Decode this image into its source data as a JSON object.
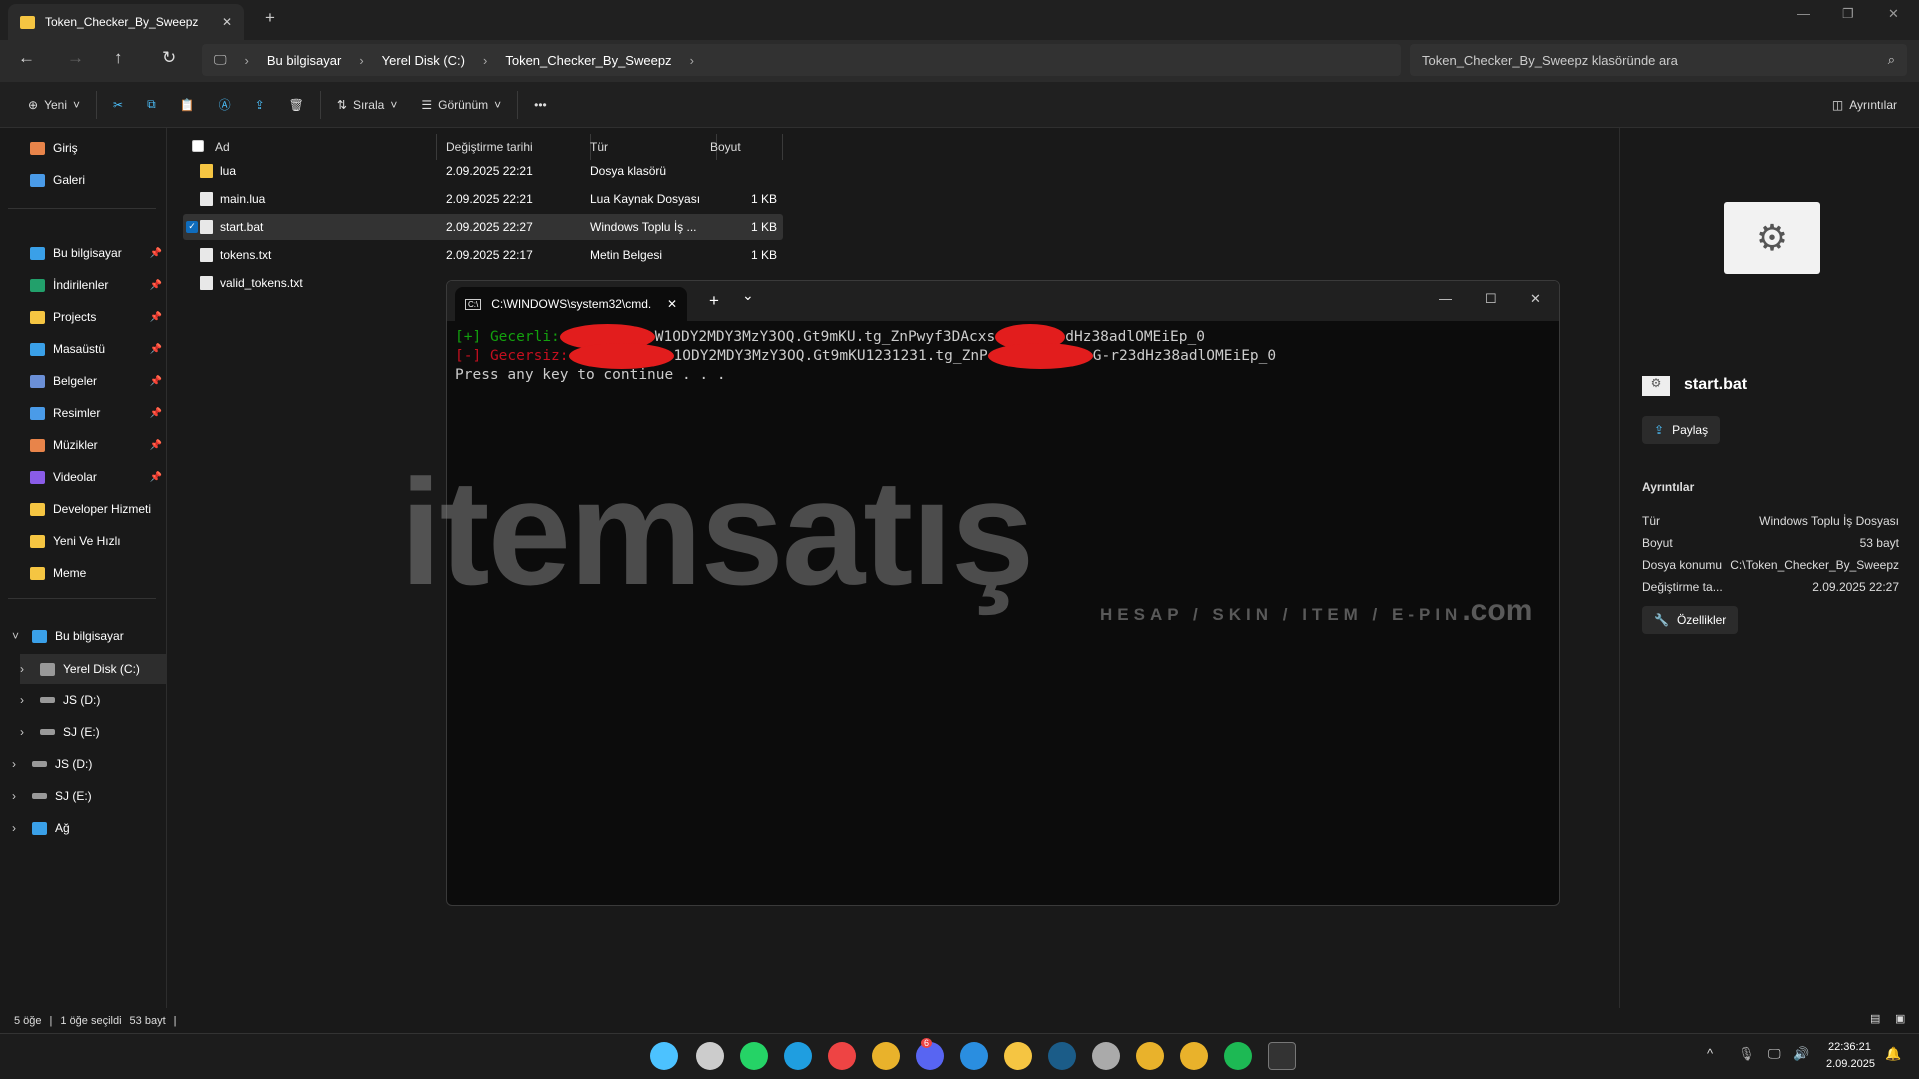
{
  "window": {
    "tab_title": "Token_Checker_By_Sweepz",
    "close": "✕",
    "new_tab": "+",
    "min": "—",
    "max": "❐",
    "closewin": "✕"
  },
  "nav": {
    "breadcrumb": [
      "Bu bilgisayar",
      "Yerel Disk (C:)",
      "Token_Checker_By_Sweepz"
    ],
    "search_placeholder": "Token_Checker_By_Sweepz klasöründe ara"
  },
  "toolbar": {
    "new": "Yeni",
    "sort": "Sırala",
    "view": "Görünüm",
    "more": "•••",
    "details": "Ayrıntılar"
  },
  "sidebar": {
    "quick": [
      "Giriş",
      "Galeri"
    ],
    "pinned": [
      "Bu bilgisayar",
      "İndirilenler",
      "Projects",
      "Masaüstü",
      "Belgeler",
      "Resimler",
      "Müzikler",
      "Videolar",
      "Developer Hizmeti",
      "Yeni Ve Hızlı",
      "Meme"
    ],
    "tree": [
      "Bu bilgisayar",
      "Yerel Disk (C:)",
      "JS (D:)",
      "SJ (E:)",
      "JS (D:)",
      "SJ (E:)",
      "Ağ"
    ]
  },
  "columns": [
    "Ad",
    "Değiştirme tarihi",
    "Tür",
    "Boyut"
  ],
  "files": [
    {
      "name": "lua",
      "date": "2.09.2025 22:21",
      "type": "Dosya klasörü",
      "size": ""
    },
    {
      "name": "main.lua",
      "date": "2.09.2025 22:21",
      "type": "Lua Kaynak Dosyası",
      "size": "1 KB"
    },
    {
      "name": "start.bat",
      "date": "2.09.2025 22:27",
      "type": "Windows Toplu İş ...",
      "size": "1 KB"
    },
    {
      "name": "tokens.txt",
      "date": "2.09.2025 22:17",
      "type": "Metin Belgesi",
      "size": "1 KB"
    },
    {
      "name": "valid_tokens.txt",
      "date": "",
      "type": "",
      "size": ""
    }
  ],
  "terminal": {
    "tab": "C:\\WINDOWS\\system32\\cmd.",
    "plus": "+",
    "chev": "⌄",
    "l1_tag": "[+]",
    "l1_label": "Gecerli:",
    "l1_mid": "W1ODY2MDY3MzY3OQ.Gt9mKU.tg_ZnPwyf3DAcxs",
    "l1_end": "dHz38adlOMEiEp_0",
    "l2_tag": "[-]",
    "l2_label": "Gecersiz:",
    "l2_mid": "1ODY2MDY3MzY3OQ.Gt9mKU1231231.tg_ZnP",
    "l2_end": "G-r23dHz38adlOMEiEp_0",
    "l3": "Press any key to continue . . ."
  },
  "watermark": {
    "brand": "itemsatış",
    "sub": "HESAP / SKIN / ITEM / E-PIN",
    "com": ".com"
  },
  "details": {
    "filename": "start.bat",
    "share": "Paylaş",
    "section": "Ayrıntılar",
    "rows": [
      {
        "k": "Tür",
        "v": "Windows Toplu İş Dosyası"
      },
      {
        "k": "Boyut",
        "v": "53 bayt"
      },
      {
        "k": "Dosya konumu",
        "v": "C:\\Token_Checker_By_Sweepz"
      },
      {
        "k": "Değiştirme ta...",
        "v": "2.09.2025 22:27"
      }
    ],
    "properties": "Özellikler"
  },
  "status": {
    "count": "5 öğe",
    "selected": "1 öğe seçildi",
    "size": "53 bayt"
  },
  "clock": {
    "time": "22:36:21",
    "date": "2.09.2025"
  },
  "badges": {
    "discord": "6"
  }
}
